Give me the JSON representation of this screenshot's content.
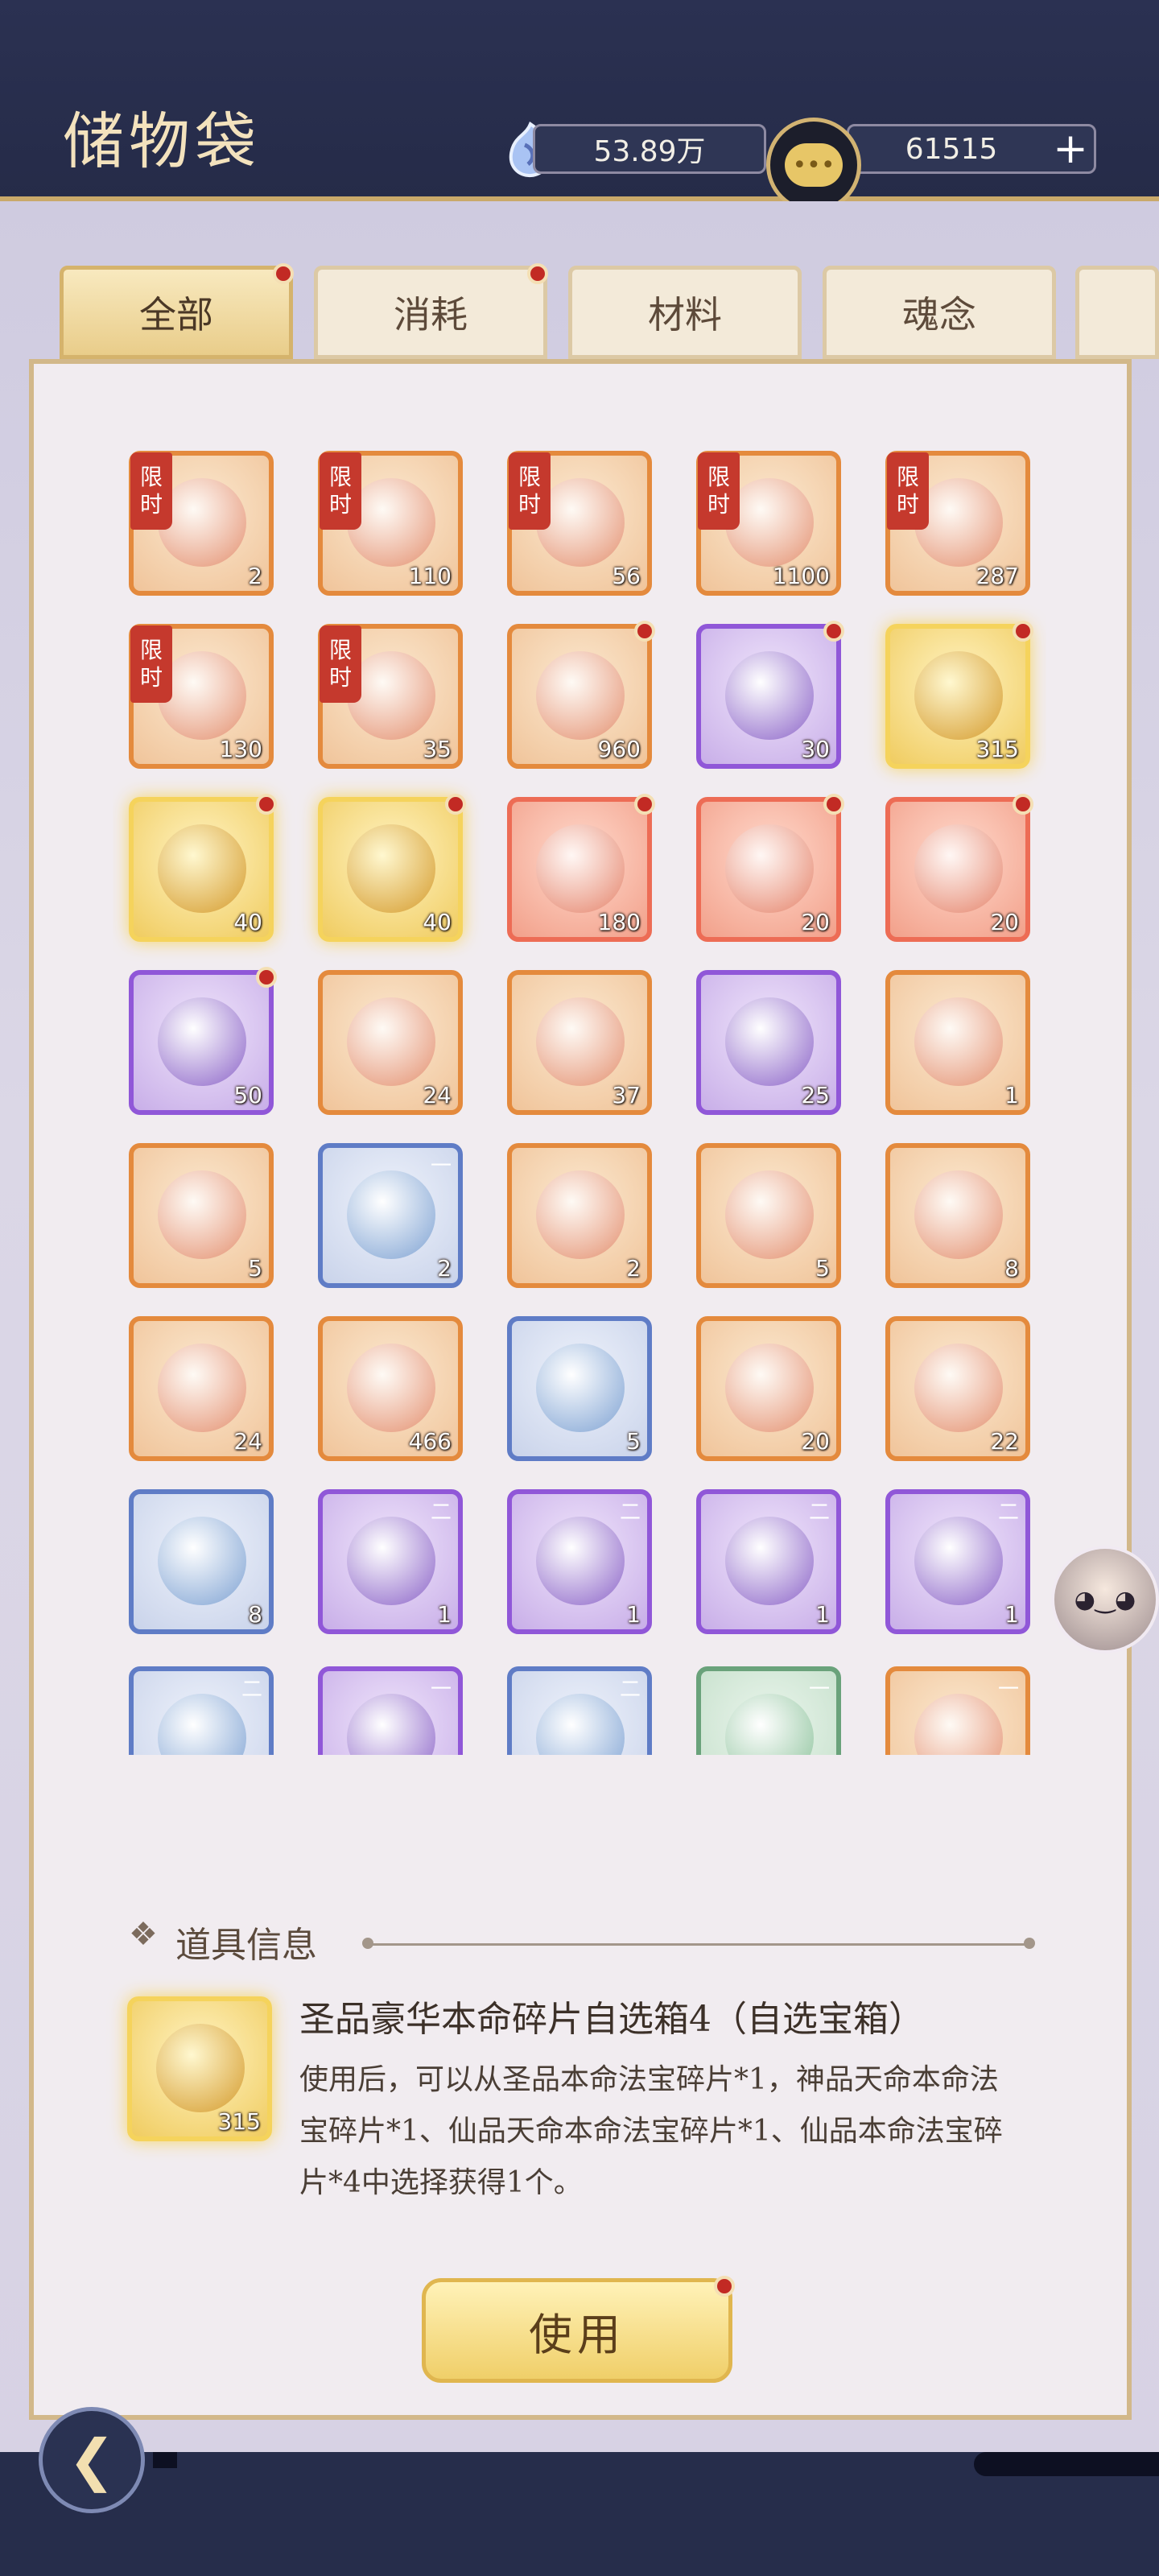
{
  "header": {
    "title": "储物袋",
    "currency1": {
      "icon": "spirit-gem-icon",
      "value": "53.89万"
    },
    "currency2": {
      "icon": "coin-icon",
      "value": "61515",
      "add_label": "+"
    }
  },
  "tabs": [
    {
      "label": "全部",
      "active": true,
      "badge": true
    },
    {
      "label": "消耗",
      "active": false,
      "badge": true
    },
    {
      "label": "材料",
      "active": false,
      "badge": false
    },
    {
      "label": "魂念",
      "active": false,
      "badge": false
    }
  ],
  "limit_label": [
    "限",
    "时"
  ],
  "items": [
    {
      "count": "2",
      "rarity": "orange",
      "limited": true,
      "badge": false
    },
    {
      "count": "110",
      "rarity": "orange",
      "limited": true,
      "badge": false
    },
    {
      "count": "56",
      "rarity": "orange",
      "limited": true,
      "badge": false
    },
    {
      "count": "1100",
      "rarity": "orange",
      "limited": true,
      "badge": false
    },
    {
      "count": "287",
      "rarity": "orange",
      "limited": true,
      "badge": false
    },
    {
      "count": "130",
      "rarity": "orange",
      "limited": true,
      "badge": false
    },
    {
      "count": "35",
      "rarity": "orange",
      "limited": true,
      "badge": false
    },
    {
      "count": "960",
      "rarity": "orange",
      "limited": false,
      "badge": true
    },
    {
      "count": "30",
      "rarity": "purple",
      "limited": false,
      "badge": true
    },
    {
      "count": "315",
      "rarity": "gold",
      "limited": false,
      "badge": true
    },
    {
      "count": "40",
      "rarity": "gold",
      "limited": false,
      "badge": true
    },
    {
      "count": "40",
      "rarity": "gold",
      "limited": false,
      "badge": true
    },
    {
      "count": "180",
      "rarity": "red",
      "limited": false,
      "badge": true
    },
    {
      "count": "20",
      "rarity": "red",
      "limited": false,
      "badge": true
    },
    {
      "count": "20",
      "rarity": "red",
      "limited": false,
      "badge": true
    },
    {
      "count": "50",
      "rarity": "purple",
      "limited": false,
      "badge": true
    },
    {
      "count": "24",
      "rarity": "orange",
      "limited": false,
      "badge": false
    },
    {
      "count": "37",
      "rarity": "orange",
      "limited": false,
      "badge": false
    },
    {
      "count": "25",
      "rarity": "purple",
      "limited": false,
      "badge": false
    },
    {
      "count": "1",
      "rarity": "orange",
      "limited": false,
      "badge": false
    },
    {
      "count": "5",
      "rarity": "orange",
      "limited": false,
      "badge": false
    },
    {
      "count": "2",
      "rarity": "blue",
      "limited": false,
      "badge": false,
      "grade": "一"
    },
    {
      "count": "2",
      "rarity": "orange",
      "limited": false,
      "badge": false
    },
    {
      "count": "5",
      "rarity": "orange",
      "limited": false,
      "badge": false
    },
    {
      "count": "8",
      "rarity": "orange",
      "limited": false,
      "badge": false
    },
    {
      "count": "24",
      "rarity": "orange",
      "limited": false,
      "badge": false
    },
    {
      "count": "466",
      "rarity": "orange",
      "limited": false,
      "badge": false
    },
    {
      "count": "5",
      "rarity": "blue",
      "limited": false,
      "badge": false
    },
    {
      "count": "20",
      "rarity": "orange",
      "limited": false,
      "badge": false
    },
    {
      "count": "22",
      "rarity": "orange",
      "limited": false,
      "badge": false
    },
    {
      "count": "8",
      "rarity": "blue",
      "limited": false,
      "badge": false
    },
    {
      "count": "1",
      "rarity": "purple",
      "limited": false,
      "badge": false,
      "grade": "二"
    },
    {
      "count": "1",
      "rarity": "purple",
      "limited": false,
      "badge": false,
      "grade": "二"
    },
    {
      "count": "1",
      "rarity": "purple",
      "limited": false,
      "badge": false,
      "grade": "二"
    },
    {
      "count": "1",
      "rarity": "purple",
      "limited": false,
      "badge": false,
      "grade": "二"
    },
    {
      "count": "",
      "rarity": "blue",
      "limited": false,
      "badge": false,
      "grade": "二"
    },
    {
      "count": "",
      "rarity": "purple",
      "limited": false,
      "badge": false,
      "grade": "一"
    },
    {
      "count": "",
      "rarity": "blue",
      "limited": false,
      "badge": false,
      "grade": "二"
    },
    {
      "count": "",
      "rarity": "green",
      "limited": false,
      "badge": false,
      "grade": "一"
    },
    {
      "count": "",
      "rarity": "orange",
      "limited": false,
      "badge": false,
      "grade": "一"
    }
  ],
  "info": {
    "section_icon": "diamond-ornament-icon",
    "section_title": "道具信息",
    "selected_count": "315",
    "item_name": "圣品豪华本命碎片自选箱4（自选宝箱）",
    "item_desc": "使用后，可以从圣品本命法宝碎片*1，神品天命本命法宝碎片*1、仙品天命本命法宝碎片*1、仙品本命法宝碎片*4中选择获得1个。"
  },
  "use_button": {
    "label": "使用",
    "badge": true
  },
  "back_button": {
    "icon": "back-arrow-icon",
    "glyph": "❮"
  },
  "companion": {
    "icon": "companion-avatar-icon"
  },
  "colors": {
    "header_bg": "#2b3152",
    "gold": "#f5d35c",
    "orange": "#e48a3d",
    "red": "#ed6c55",
    "purple": "#9057d8",
    "blue": "#5f7cc6",
    "green": "#6aa27b",
    "badge": "#c22a24"
  }
}
